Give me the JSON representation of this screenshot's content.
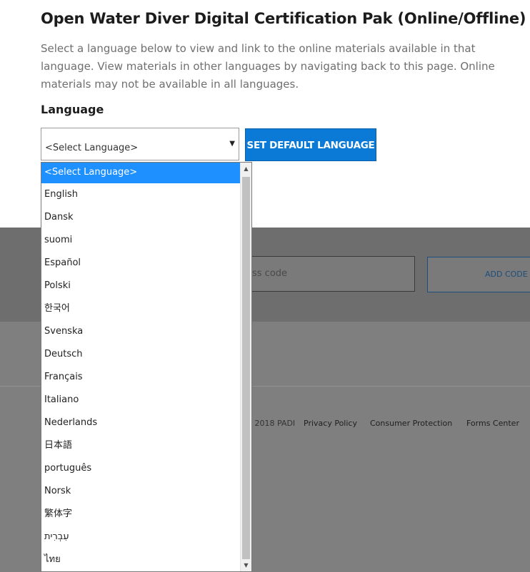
{
  "page": {
    "title": "Open Water Diver Digital Certification Pak (Online/Offline)",
    "intro": "Select a language below to view and link to the online materials available in that language. View materials in other languages by navigating back to this page. Online materials may not be available in all languages.",
    "language_label": "Language"
  },
  "language_select": {
    "selected_value": "<Select Language>",
    "arrow_icon": "caret-down-icon",
    "options": [
      "<Select Language>",
      "English",
      "Dansk",
      "suomi",
      "Español",
      "Polski",
      "한국어",
      "Svenska",
      "Deutsch",
      "Français",
      "Italiano",
      "Nederlands",
      "日本語",
      "português",
      "Norsk",
      "繁体字",
      "עִבְרִית",
      "ไทย"
    ]
  },
  "set_default_button": {
    "label": "SET DEFAULT LANGUAGE"
  },
  "access_code": {
    "placeholder_visible": "ss code",
    "add_button_label": "ADD CODE"
  },
  "footer": {
    "copyright": "© 2018 PADI",
    "links": [
      "Privacy Policy",
      "Consumer Protection",
      "Forms Center"
    ]
  },
  "colors": {
    "primary_button": "#0a7ad6",
    "selected_option": "#1e90ff",
    "overlay_dark": "#6e6e6e"
  }
}
